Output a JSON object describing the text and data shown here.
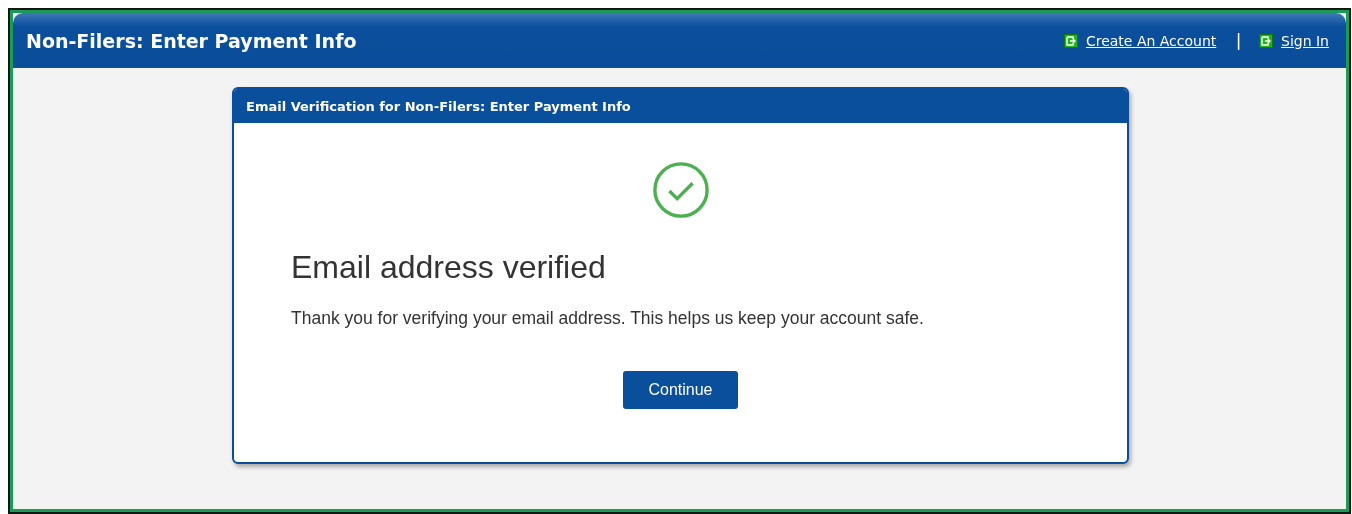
{
  "header": {
    "title": "Non-Filers: Enter Payment Info",
    "links": [
      {
        "label": "Create An Account"
      },
      {
        "label": "Sign In"
      }
    ],
    "separator": "|"
  },
  "card": {
    "title": "Email Verification for Non-Filers: Enter Payment Info",
    "heading": "Email address verified",
    "message": "Thank you for verifying your email address. This helps us keep your account safe.",
    "button": "Continue"
  }
}
